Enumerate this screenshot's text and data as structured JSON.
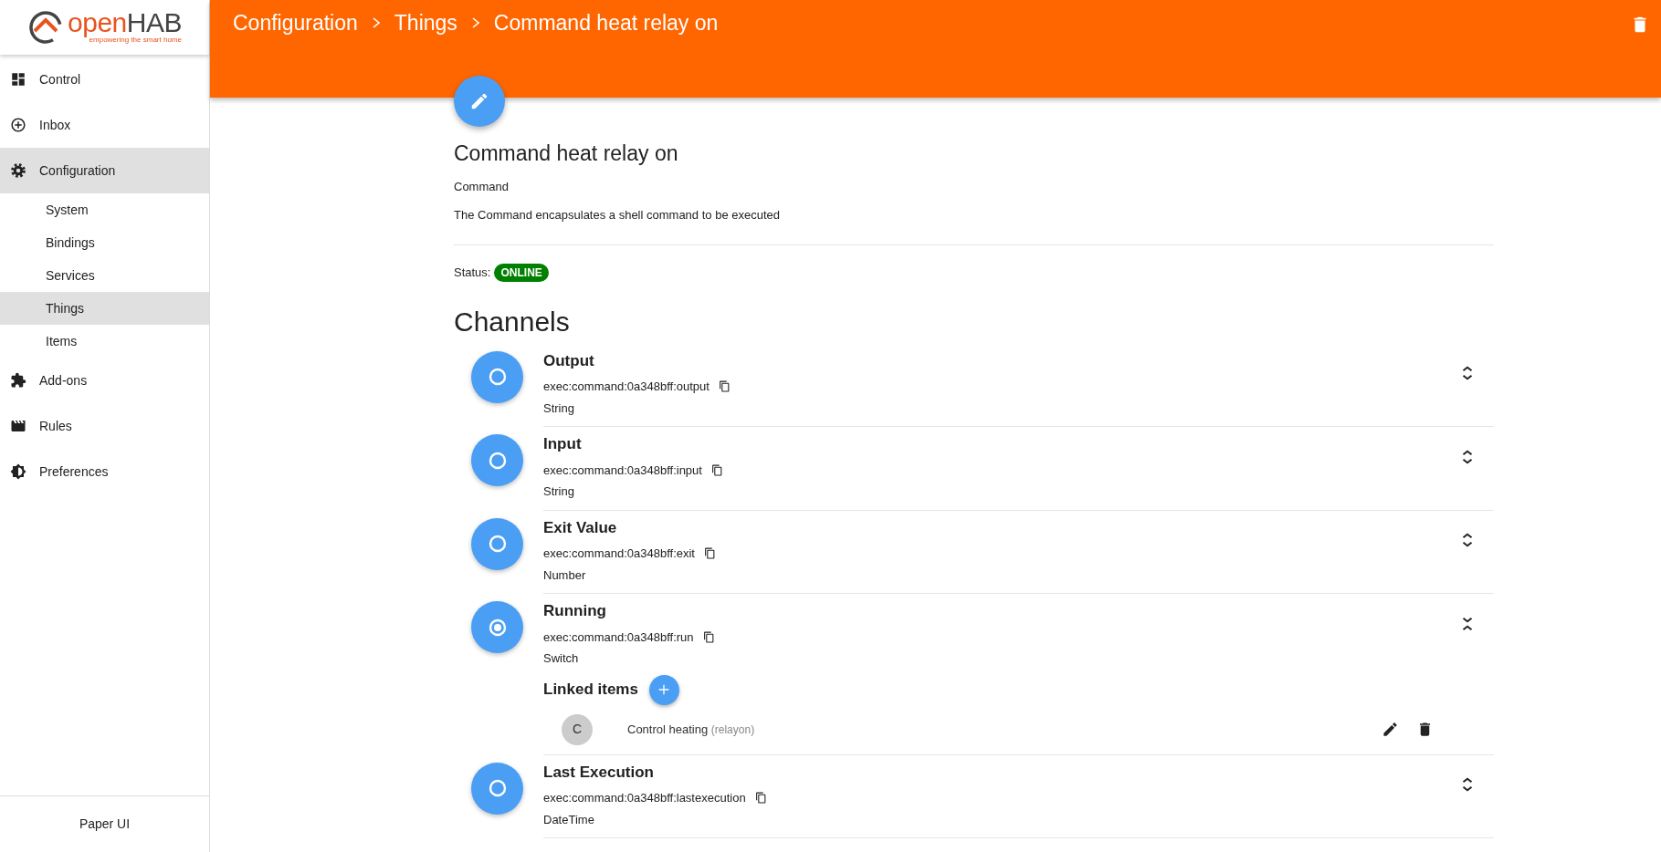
{
  "logo": {
    "brand_first": "open",
    "brand_second": "HAB",
    "tagline": "empowering the smart home"
  },
  "sidebar": {
    "items": [
      {
        "label": "Control",
        "selected": false
      },
      {
        "label": "Inbox",
        "selected": false
      },
      {
        "label": "Configuration",
        "selected": true,
        "children": [
          {
            "label": "System",
            "selected": false
          },
          {
            "label": "Bindings",
            "selected": false
          },
          {
            "label": "Services",
            "selected": false
          },
          {
            "label": "Things",
            "selected": true
          },
          {
            "label": "Items",
            "selected": false
          }
        ]
      },
      {
        "label": "Add-ons",
        "selected": false
      },
      {
        "label": "Rules",
        "selected": false
      },
      {
        "label": "Preferences",
        "selected": false
      }
    ],
    "footer": "Paper UI"
  },
  "header": {
    "breadcrumb": [
      "Configuration",
      "Things",
      "Command heat relay on"
    ]
  },
  "thing": {
    "title": "Command heat relay on",
    "type": "Command",
    "description": "The Command encapsulates a shell command to be executed",
    "status_label": "Status:",
    "status": "ONLINE"
  },
  "channels_title": "Channels",
  "channels": [
    {
      "name": "Output",
      "uid": "exec:command:0a348bff:output",
      "type": "String",
      "linked": false,
      "expanded": false
    },
    {
      "name": "Input",
      "uid": "exec:command:0a348bff:input",
      "type": "String",
      "linked": false,
      "expanded": false
    },
    {
      "name": "Exit Value",
      "uid": "exec:command:0a348bff:exit",
      "type": "Number",
      "linked": false,
      "expanded": false
    },
    {
      "name": "Running",
      "uid": "exec:command:0a348bff:run",
      "type": "Switch",
      "linked": true,
      "expanded": true,
      "linked_items_title": "Linked items",
      "linked_items": [
        {
          "avatar": "C",
          "label": "Control heating",
          "item_name": "(relayon)"
        }
      ]
    },
    {
      "name": "Last Execution",
      "uid": "exec:command:0a348bff:lastexecution",
      "type": "DateTime",
      "linked": false,
      "expanded": false
    }
  ]
}
